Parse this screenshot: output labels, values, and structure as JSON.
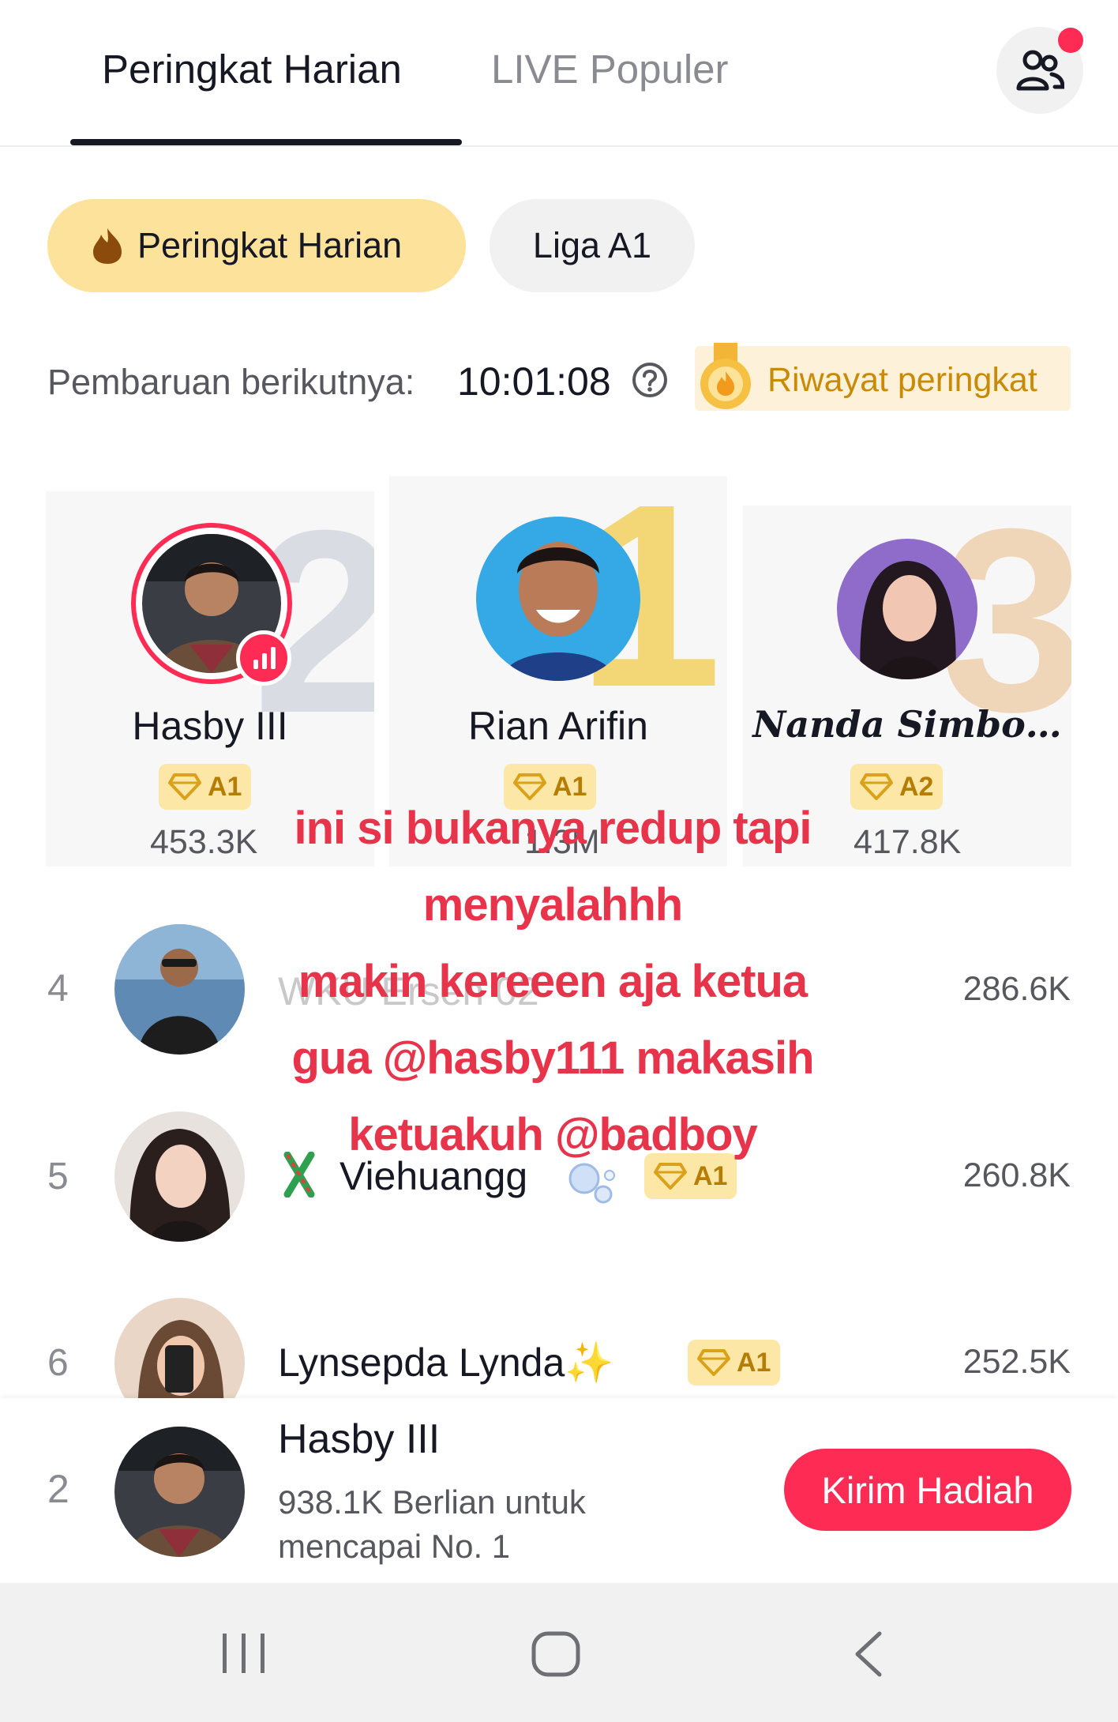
{
  "tabs": {
    "active": "Peringkat Harian",
    "inactive": "LIVE Populer"
  },
  "pills": {
    "daily": "Peringkat Harian",
    "league": "Liga A1"
  },
  "update": {
    "label": "Pembaruan berikutnya:",
    "time": "10:01:08",
    "history": "Riwayat peringkat"
  },
  "podium": [
    {
      "place": "2",
      "name": "Hasby III",
      "tier": "A1",
      "score": "453.3K"
    },
    {
      "place": "1",
      "name": "Rian Arifin",
      "tier": "A1",
      "score": "1.3M"
    },
    {
      "place": "3",
      "name": "Nanda Simbo…",
      "tier": "A2",
      "score": "417.8K"
    }
  ],
  "rows": [
    {
      "rank": "4",
      "name": "WKU Ersen 02",
      "score": "286.6K"
    },
    {
      "rank": "5",
      "name": "Viehuangg",
      "tier": "A1",
      "score": "260.8K"
    },
    {
      "rank": "6",
      "name": "Lynsepda  Lynda✨",
      "tier": "A1",
      "score": "252.5K"
    }
  ],
  "caption": [
    "ini si bukanya redup tapi",
    "menyalahhh",
    "makin kereeen aja ketua",
    "gua @hasby111 makasih",
    "ketuakuh @badboy"
  ],
  "self": {
    "rank": "2",
    "name": "Hasby III",
    "subtitle": "938.1K Berlian untuk mencapai No. 1",
    "button": "Kirim Hadiah"
  },
  "colors": {
    "accent": "#fe2c55",
    "gold_pill": "#fce29a",
    "tier_bg": "#fce7a6",
    "caption": "#e8344a"
  }
}
